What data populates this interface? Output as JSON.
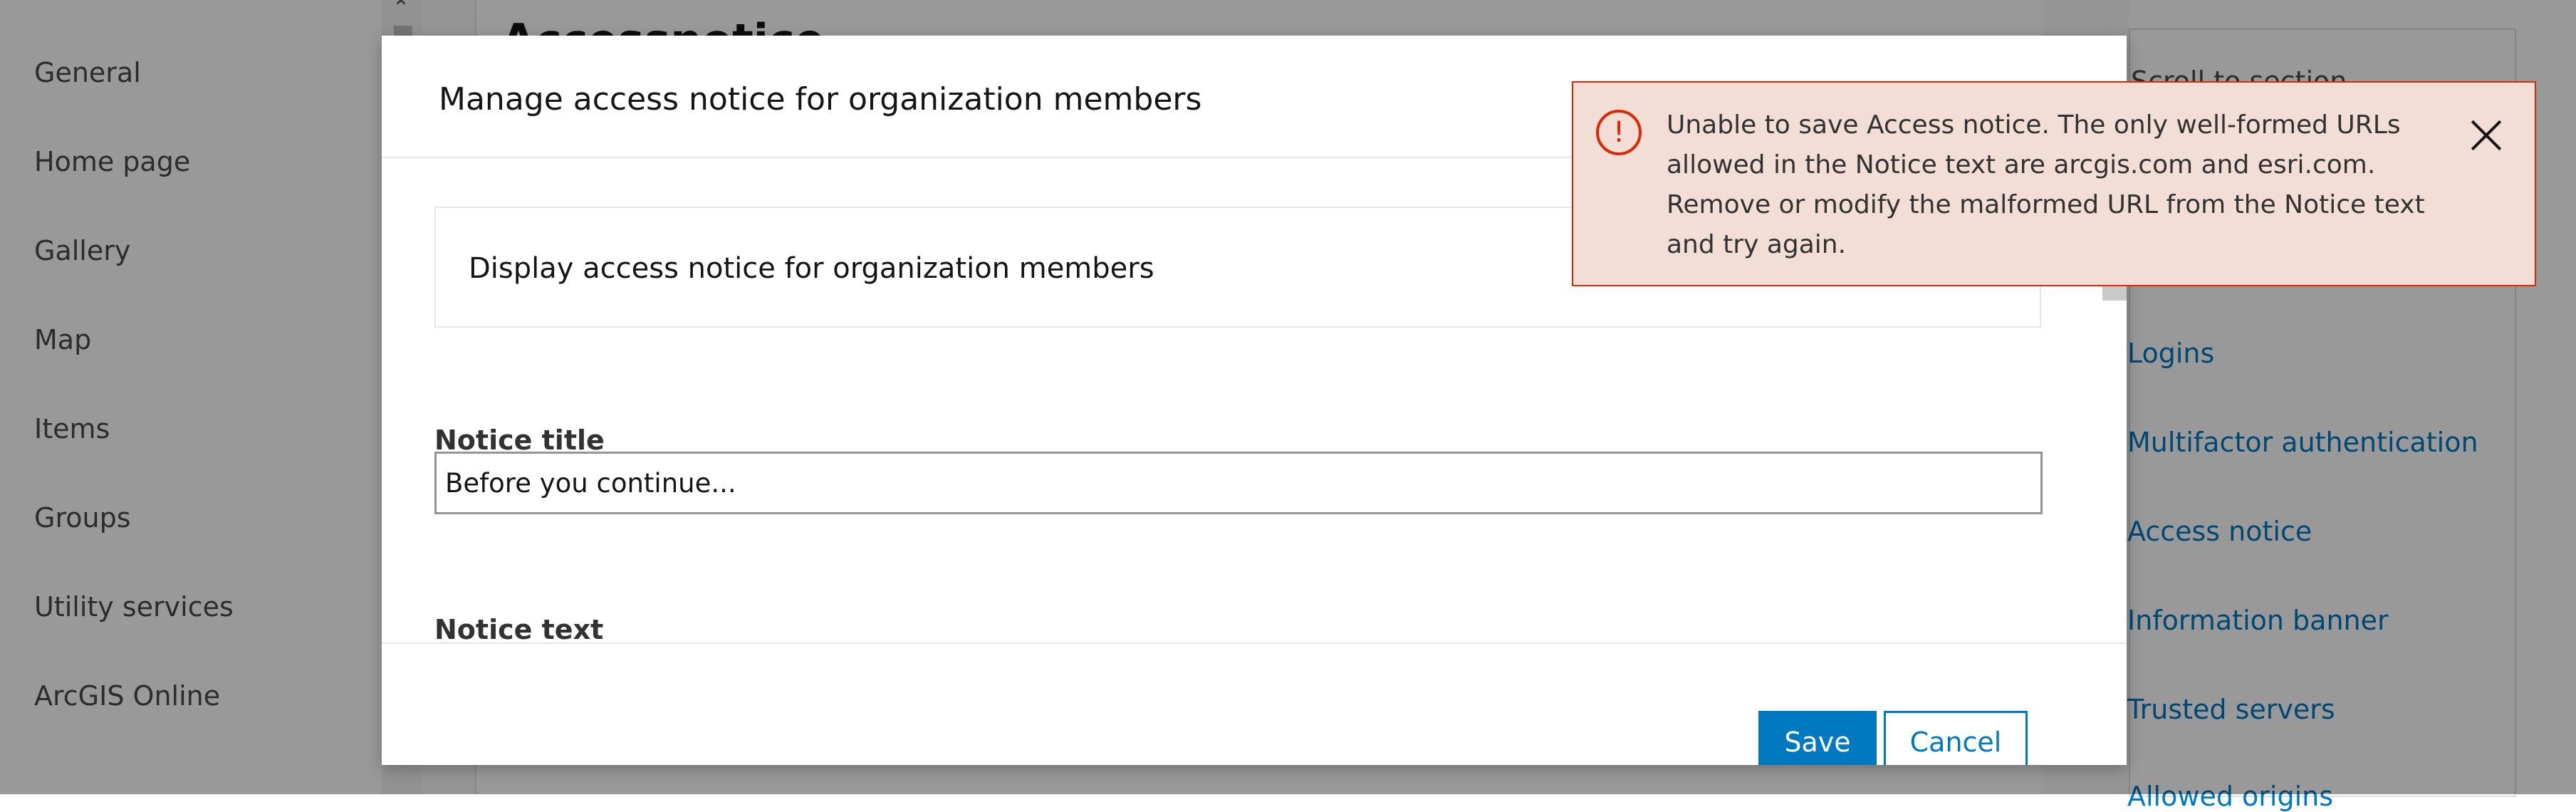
{
  "left_nav": {
    "items": [
      {
        "label": "General"
      },
      {
        "label": "Home page"
      },
      {
        "label": "Gallery"
      },
      {
        "label": "Map"
      },
      {
        "label": "Items"
      },
      {
        "label": "Groups"
      },
      {
        "label": "Utility services"
      },
      {
        "label": "ArcGIS Online"
      }
    ]
  },
  "main": {
    "heading": "Accessnotice"
  },
  "right_panel": {
    "scroll_to_section": "Scroll to section",
    "links": [
      {
        "label": "Logins"
      },
      {
        "label": "Multifactor authentication"
      },
      {
        "label": "Access notice"
      },
      {
        "label": "Information banner"
      },
      {
        "label": "Trusted servers"
      },
      {
        "label": "Allowed origins"
      }
    ]
  },
  "modal": {
    "title": "Manage access notice for organization members",
    "toggle_label": "Display access notice for organization members",
    "notice_title_label": "Notice title",
    "notice_title_value": "Before you continue...",
    "notice_text_label": "Notice text",
    "save_label": "Save",
    "cancel_label": "Cancel"
  },
  "alert": {
    "message": "Unable to save Access notice. The only well-formed URLs allowed in the Notice text are arcgis.com and esri.com. Remove or modify the malformed URL from the Notice text and try again.",
    "icon_glyph": "!",
    "color": "#de2900",
    "background": "#f3ded7"
  },
  "colors": {
    "accent": "#0079c1",
    "error": "#de2900"
  }
}
